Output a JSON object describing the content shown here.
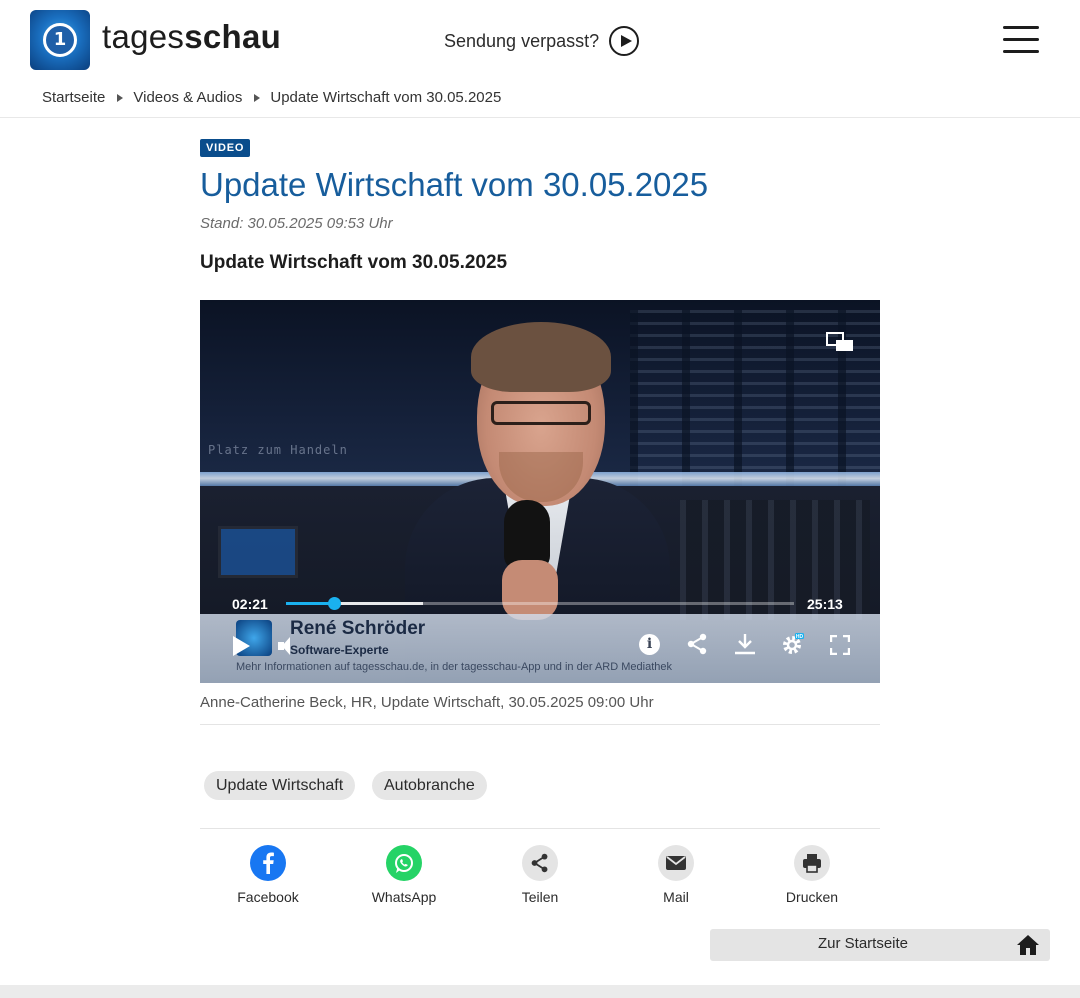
{
  "header": {
    "brand_light": "tages",
    "brand_bold": "schau",
    "missed_label": "Sendung verpasst?"
  },
  "breadcrumb": {
    "items": [
      "Startseite",
      "Videos & Audios",
      "Update Wirtschaft vom 30.05.2025"
    ]
  },
  "article": {
    "badge": "VIDEO",
    "title": "Update Wirtschaft vom 30.05.2025",
    "stand": "Stand: 30.05.2025 09:53 Uhr",
    "subtitle": "Update Wirtschaft vom 30.05.2025"
  },
  "video": {
    "current_time": "02:21",
    "total_time": "25:13",
    "played_fraction": 0.094,
    "buffered_fraction": 0.27,
    "lower_third": {
      "name": "René Schröder",
      "role": "Software-Experte",
      "info": "Mehr Informationen auf tagesschau.de, in der tagesschau-App und in der ARD Mediathek"
    },
    "hd_badge": "HD",
    "info_glyph": "i",
    "accent_color": "#1ab1ef"
  },
  "caption": "Anne-Catherine Beck, HR, Update Wirtschaft, 30.05.2025 09:00 Uhr",
  "tags": [
    "Update Wirtschaft",
    "Autobranche"
  ],
  "share": [
    {
      "label": "Facebook",
      "icon": "facebook-icon",
      "color": "#1877f2"
    },
    {
      "label": "WhatsApp",
      "icon": "whatsapp-icon",
      "color": "#25d366"
    },
    {
      "label": "Teilen",
      "icon": "share-icon",
      "color": "#e4e4e4"
    },
    {
      "label": "Mail",
      "icon": "mail-icon",
      "color": "#e4e4e4"
    },
    {
      "label": "Drucken",
      "icon": "print-icon",
      "color": "#e4e4e4"
    }
  ],
  "home_button": "Zur Startseite",
  "colors": {
    "brand_blue": "#175d9c",
    "badge_blue": "#0a4d8c"
  }
}
